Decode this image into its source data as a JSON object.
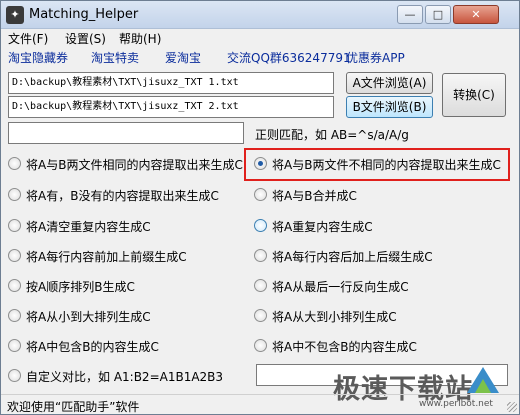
{
  "window": {
    "title": "Matching_Helper",
    "icon": "app-icon"
  },
  "window_controls": {
    "minimize": "—",
    "maximize": "□",
    "close": "✕"
  },
  "menu": [
    "文件(F)",
    "设置(S)",
    "帮助(H)"
  ],
  "links": [
    "淘宝隐藏券",
    "淘宝特卖",
    "爱淘宝",
    "交流QQ群636247791",
    "优惠券APP"
  ],
  "file_a": {
    "path": "D:\\backup\\教程素材\\TXT\\jisuxz_TXT 1.txt",
    "button": "A文件浏览(A)"
  },
  "file_b": {
    "path": "D:\\backup\\教程素材\\TXT\\jisuxz_TXT 2.txt",
    "button": "B文件浏览(B)"
  },
  "convert_button": "转换(C)",
  "regex": {
    "value": "",
    "label": "正则匹配，如 AB=^s/a/A/g"
  },
  "options": [
    "将A与B两文件相同的内容提取出来生成C",
    "将A与B两文件不相同的内容提取出来生成C",
    "将A有，B没有的内容提取出来生成C",
    "将A与B合并成C",
    "将A清空重复内容生成C",
    "将A重复内容生成C",
    "将A每行内容前加上前缀生成C",
    "将A每行内容后加上后缀生成C",
    "按A顺序排列B生成C",
    "将A从最后一行反向生成C",
    "将A从小到大排列生成C",
    "将A从大到小排列生成C",
    "将A中包含B的内容生成C",
    "将A中不包含B的内容生成C",
    "自定义对比，如 A1:B2=A1B1A2B3"
  ],
  "selected_option_index": 1,
  "custom_value": "",
  "status": "欢迎使用“匹配助手”软件",
  "watermark": {
    "text": "极速下载站",
    "url": "www.perlbot.net"
  }
}
